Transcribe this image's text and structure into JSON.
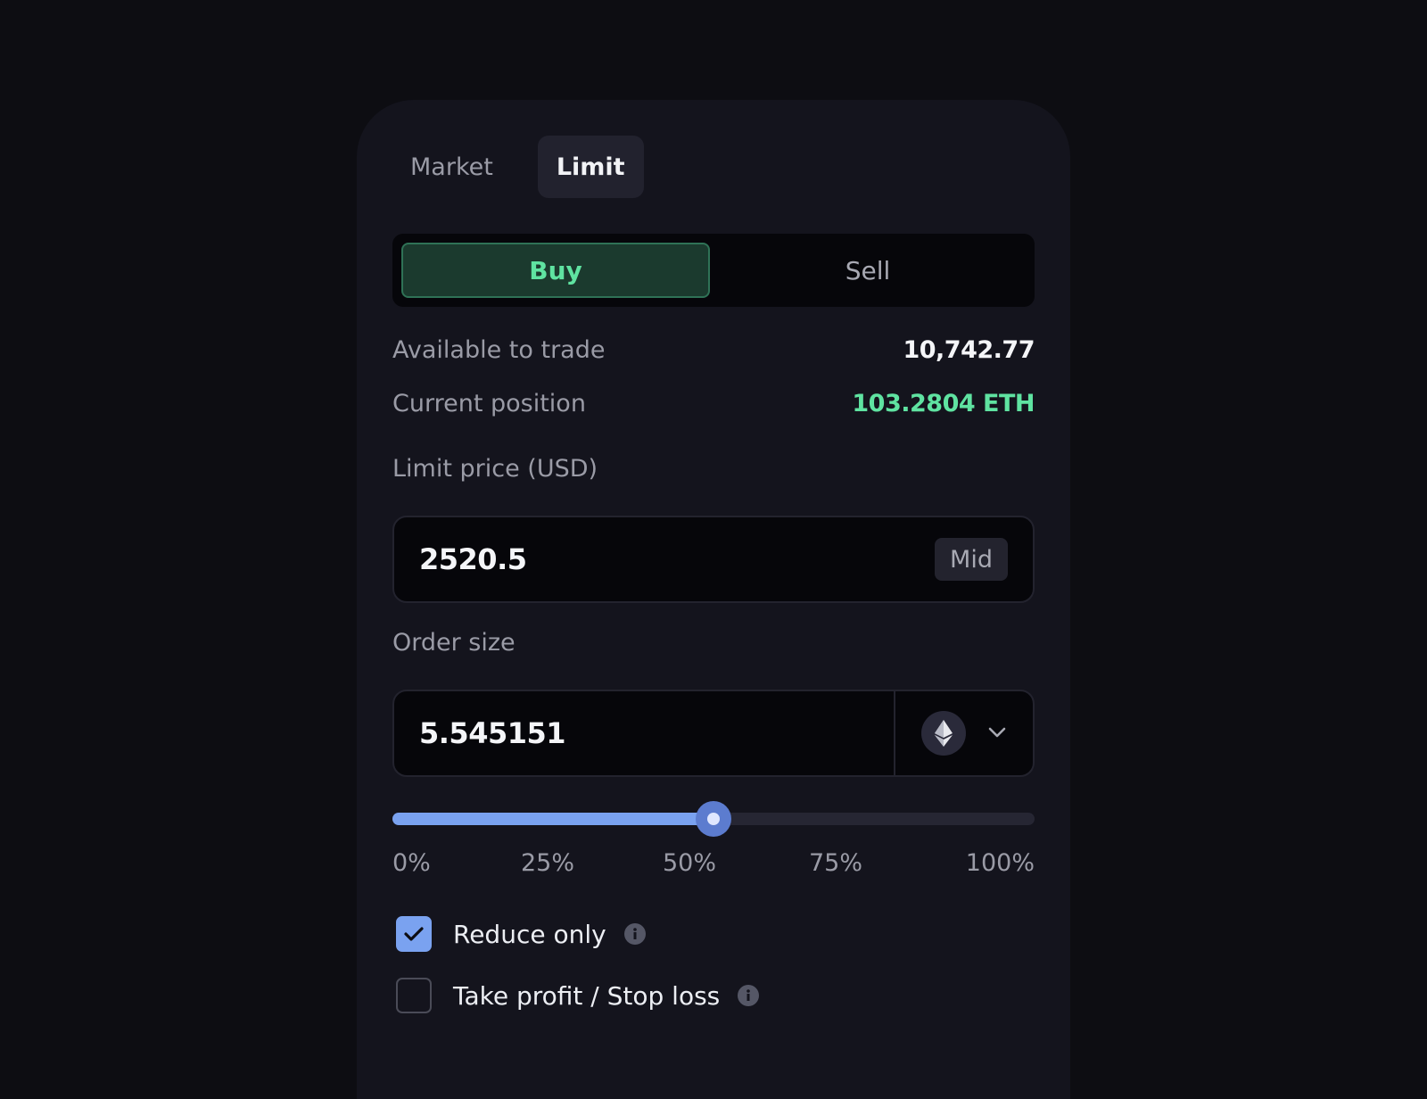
{
  "order_type_tabs": [
    {
      "label": "Market",
      "active": false
    },
    {
      "label": "Limit",
      "active": true
    }
  ],
  "side_toggle": {
    "buy_label": "Buy",
    "sell_label": "Sell",
    "selected": "Buy"
  },
  "account": {
    "available_label": "Available to trade",
    "available_value": "10,742.77",
    "position_label": "Current position",
    "position_value": "103.2804 ETH"
  },
  "limit_price": {
    "label": "Limit price (USD)",
    "value": "2520.5",
    "mid_button_label": "Mid"
  },
  "order_size": {
    "label": "Order size",
    "value": "5.545151",
    "asset_icon": "eth-icon"
  },
  "size_slider": {
    "percent": 50,
    "ticks": [
      "0%",
      "25%",
      "50%",
      "75%",
      "100%"
    ]
  },
  "options": {
    "reduce_only_label": "Reduce only",
    "reduce_only_checked": true,
    "tpsl_label": "Take profit / Stop loss",
    "tpsl_checked": false
  },
  "colors": {
    "background": "#0d0d12",
    "panel": "#14141d",
    "buy_green": "#5fe3a1",
    "slider_blue": "#7aa2f0"
  }
}
